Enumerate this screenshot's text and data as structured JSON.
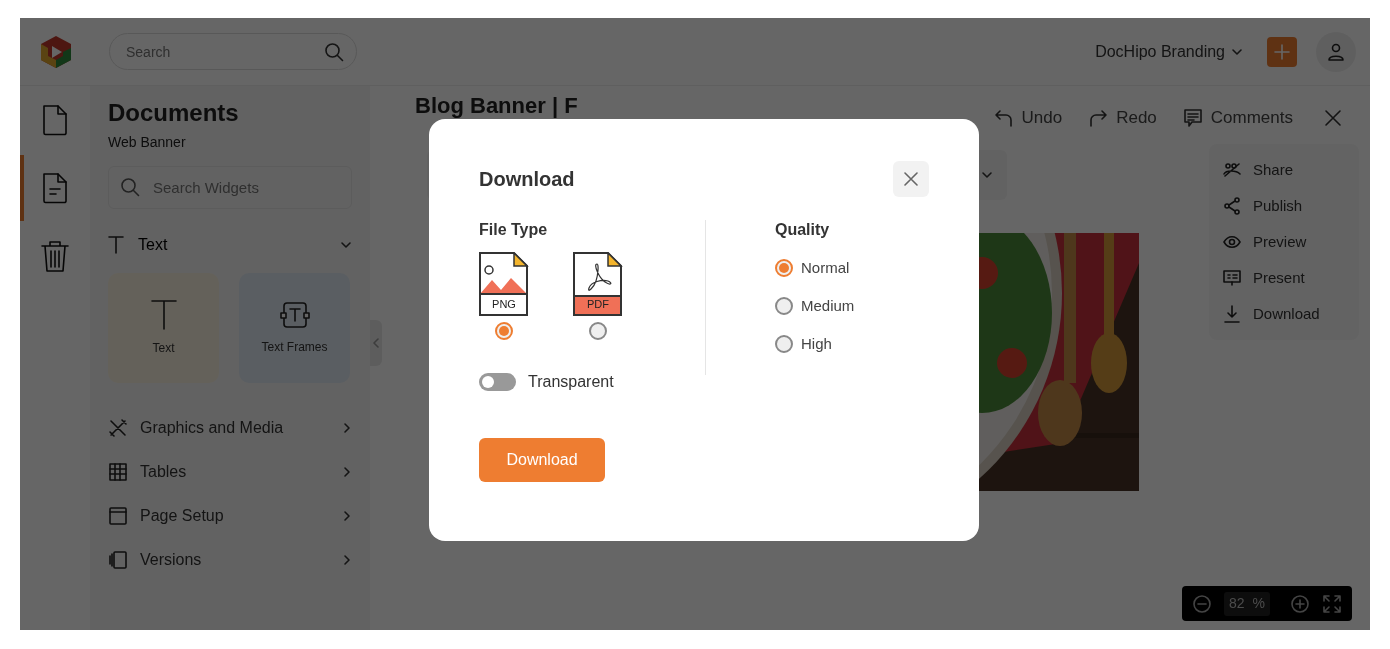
{
  "header": {
    "search": {
      "placeholder": "Search"
    },
    "workspace": "DocHipo Branding"
  },
  "rail": [
    {
      "kind": "file",
      "selected": false
    },
    {
      "kind": "document",
      "selected": true
    },
    {
      "kind": "trash",
      "selected": false
    }
  ],
  "panel": {
    "title": "Documents",
    "subtitle": "Web Banner",
    "search": {
      "placeholder": "Search Widgets"
    },
    "section": {
      "label": "Text",
      "expanded": true
    },
    "widgets": [
      {
        "label": "Text",
        "kind": "text"
      },
      {
        "label": "Text Frames",
        "kind": "frame"
      }
    ],
    "menu": [
      {
        "label": "Graphics and Media",
        "kind": "graphics"
      },
      {
        "label": "Tables",
        "kind": "table"
      },
      {
        "label": "Page Setup",
        "kind": "page"
      },
      {
        "label": "Versions",
        "kind": "versions"
      }
    ]
  },
  "editor": {
    "title": "Blog Banner | F",
    "actions": [
      {
        "label": "Undo",
        "kind": "undo"
      },
      {
        "label": "Redo",
        "kind": "redo"
      },
      {
        "label": "Comments",
        "kind": "comments"
      }
    ],
    "menu": [
      {
        "label": "Share",
        "kind": "share"
      },
      {
        "label": "Publish",
        "kind": "publish"
      },
      {
        "label": "Preview",
        "kind": "preview"
      },
      {
        "label": "Present",
        "kind": "present"
      },
      {
        "label": "Download",
        "kind": "download"
      }
    ],
    "zoom": {
      "value": "82",
      "unit": "%"
    }
  },
  "modal": {
    "title": "Download",
    "file_type": {
      "label": "File Type",
      "options": [
        {
          "label": "PNG",
          "kind": "png",
          "selected": true
        },
        {
          "label": "PDF",
          "kind": "pdf",
          "selected": false
        }
      ]
    },
    "transparent": {
      "label": "Transparent",
      "on": false
    },
    "quality": {
      "label": "Quality",
      "options": [
        {
          "label": "Normal",
          "selected": true
        },
        {
          "label": "Medium",
          "selected": false
        },
        {
          "label": "High",
          "selected": false
        }
      ]
    },
    "button": "Download"
  }
}
